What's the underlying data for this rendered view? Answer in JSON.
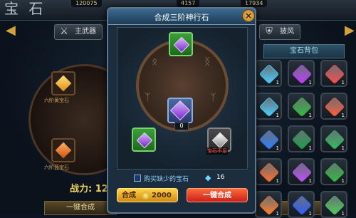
{
  "screen": {
    "title": "宝 石",
    "resources": [
      "120075",
      "4157",
      "17934"
    ]
  },
  "tabs": {
    "main_weapon": "主武器",
    "cloak": "披风"
  },
  "bag": {
    "title": "宝石背包",
    "items": [
      {
        "color": "#4ad0ff",
        "count": "1"
      },
      {
        "color": "#c040ff",
        "count": "1"
      },
      {
        "color": "#ff5050",
        "count": "1"
      },
      {
        "color": "#4ad0ff",
        "count": "1"
      },
      {
        "color": "#30c040",
        "count": "1"
      },
      {
        "color": "#ff6040",
        "count": "1"
      },
      {
        "color": "#3080ff",
        "count": "1"
      },
      {
        "color": "#20a050",
        "count": "1"
      },
      {
        "color": "#30c060",
        "count": "1"
      },
      {
        "color": "#ff7030",
        "count": "1"
      },
      {
        "color": "#c050ff",
        "count": "1"
      },
      {
        "color": "#30c040",
        "count": "1"
      },
      {
        "color": "#ff8030",
        "count": "1"
      },
      {
        "color": "#3060ff",
        "count": "1"
      },
      {
        "color": "#50d060",
        "count": "1"
      }
    ]
  },
  "left": {
    "gem_labels": [
      "六阶黄宝石",
      "六阶蓝宝石"
    ],
    "power_label": "战力: 12",
    "bottom_button": "一键合成"
  },
  "modal": {
    "title": "合成三阶神行石",
    "close_glyph": "×",
    "center_count": "0",
    "insufficient_label": "宝石不足",
    "buy_missing_label": "购买缺少的宝石",
    "diamond_cost": "16",
    "compose_label": "合成",
    "gold_cost": "2000",
    "one_click_label": "一键合成"
  },
  "colors": {
    "accent_gold": "#ffd24a",
    "accent_red": "#c8201a",
    "modal_border": "#5d7890"
  }
}
